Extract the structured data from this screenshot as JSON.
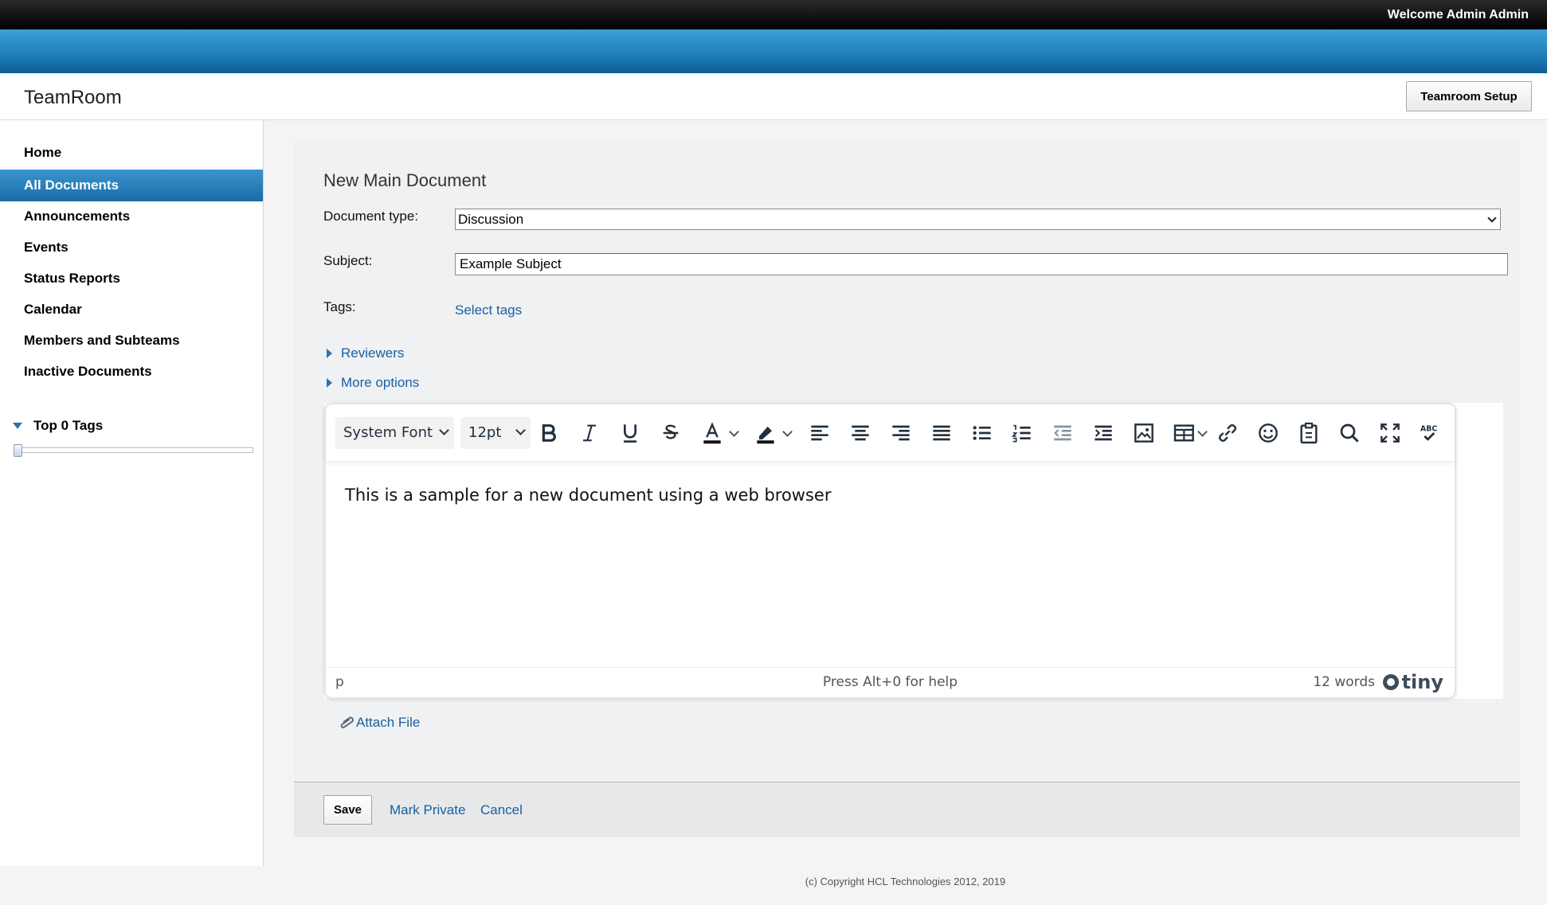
{
  "header": {
    "welcome": "Welcome Admin Admin",
    "app_title": "TeamRoom",
    "setup_button": "Teamroom Setup"
  },
  "sidebar": {
    "items": [
      {
        "label": "Home",
        "active": false
      },
      {
        "label": "All Documents",
        "active": true
      },
      {
        "label": "Announcements",
        "active": false
      },
      {
        "label": "Events",
        "active": false
      },
      {
        "label": "Status Reports",
        "active": false
      },
      {
        "label": "Calendar",
        "active": false
      },
      {
        "label": "Members and Subteams",
        "active": false
      },
      {
        "label": "Inactive Documents",
        "active": false
      }
    ],
    "tags_header": "Top 0 Tags"
  },
  "form": {
    "title": "New Main Document",
    "doctype_label": "Document type:",
    "doctype_value": "Discussion",
    "subject_label": "Subject:",
    "subject_value": "Example Subject",
    "tags_label": "Tags:",
    "select_tags": "Select tags",
    "reviewers": "Reviewers",
    "more_options": "More options",
    "attach_file": "Attach File"
  },
  "editor": {
    "font_family": "System Font",
    "font_size": "12pt",
    "toolbar_icons": [
      "bold-icon",
      "italic-icon",
      "underline-icon",
      "strikethrough-icon",
      "text-color-icon",
      "highlight-color-icon",
      "align-left-icon",
      "align-center-icon",
      "align-right-icon",
      "align-justify-icon",
      "bullet-list-icon",
      "numbered-list-icon",
      "outdent-icon",
      "indent-icon",
      "image-icon",
      "table-icon",
      "link-icon",
      "emoticons-icon",
      "paste-icon",
      "search-icon",
      "fullscreen-icon",
      "spellcheck-icon"
    ],
    "body_text": "This is a sample for a new document using a web browser",
    "status_path": "p",
    "status_help": "Press Alt+0 for help",
    "word_count": "12 words",
    "brand": "tiny"
  },
  "actions": {
    "save": "Save",
    "mark_private": "Mark Private",
    "cancel": "Cancel"
  },
  "footer": {
    "copyright": "(c) Copyright HCL Technologies 2012, 2019"
  },
  "colors": {
    "header_blue": "#1f80bd",
    "active_nav": "#1b6ca7",
    "link": "#1a5fa3",
    "content_bg": "#f0f1f2"
  }
}
